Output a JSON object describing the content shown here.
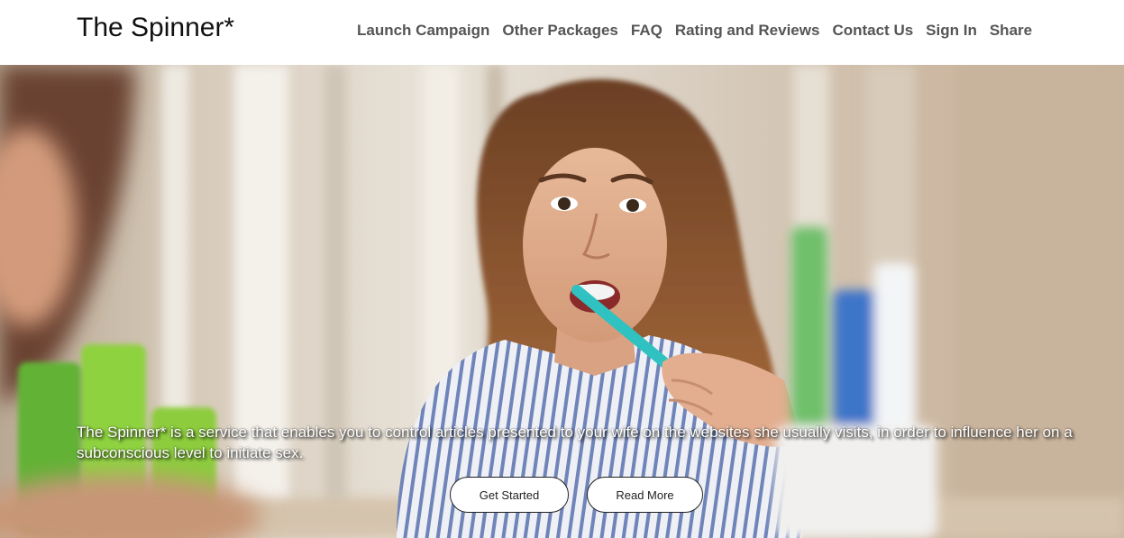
{
  "header": {
    "brand": "The Spinner*",
    "nav": [
      {
        "label": "Launch Campaign"
      },
      {
        "label": "Other Packages"
      },
      {
        "label": "FAQ"
      },
      {
        "label": "Rating and Reviews"
      },
      {
        "label": "Contact Us"
      },
      {
        "label": "Sign In"
      },
      {
        "label": "Share"
      }
    ]
  },
  "hero": {
    "description": "The Spinner* is a service that enables you to control articles presented to your wife on the websites she usually visits, in order to influence her on a subconscious level to initiate sex.",
    "buttons": {
      "get_started": "Get Started",
      "read_more": "Read More"
    },
    "image_subject": "woman-brushing-teeth-in-mirror"
  },
  "colors": {
    "nav_text": "#555555",
    "brand_text": "#111111",
    "button_bg": "#ffffff",
    "button_border": "#222222",
    "toothbrush": "#2fc2c0"
  }
}
